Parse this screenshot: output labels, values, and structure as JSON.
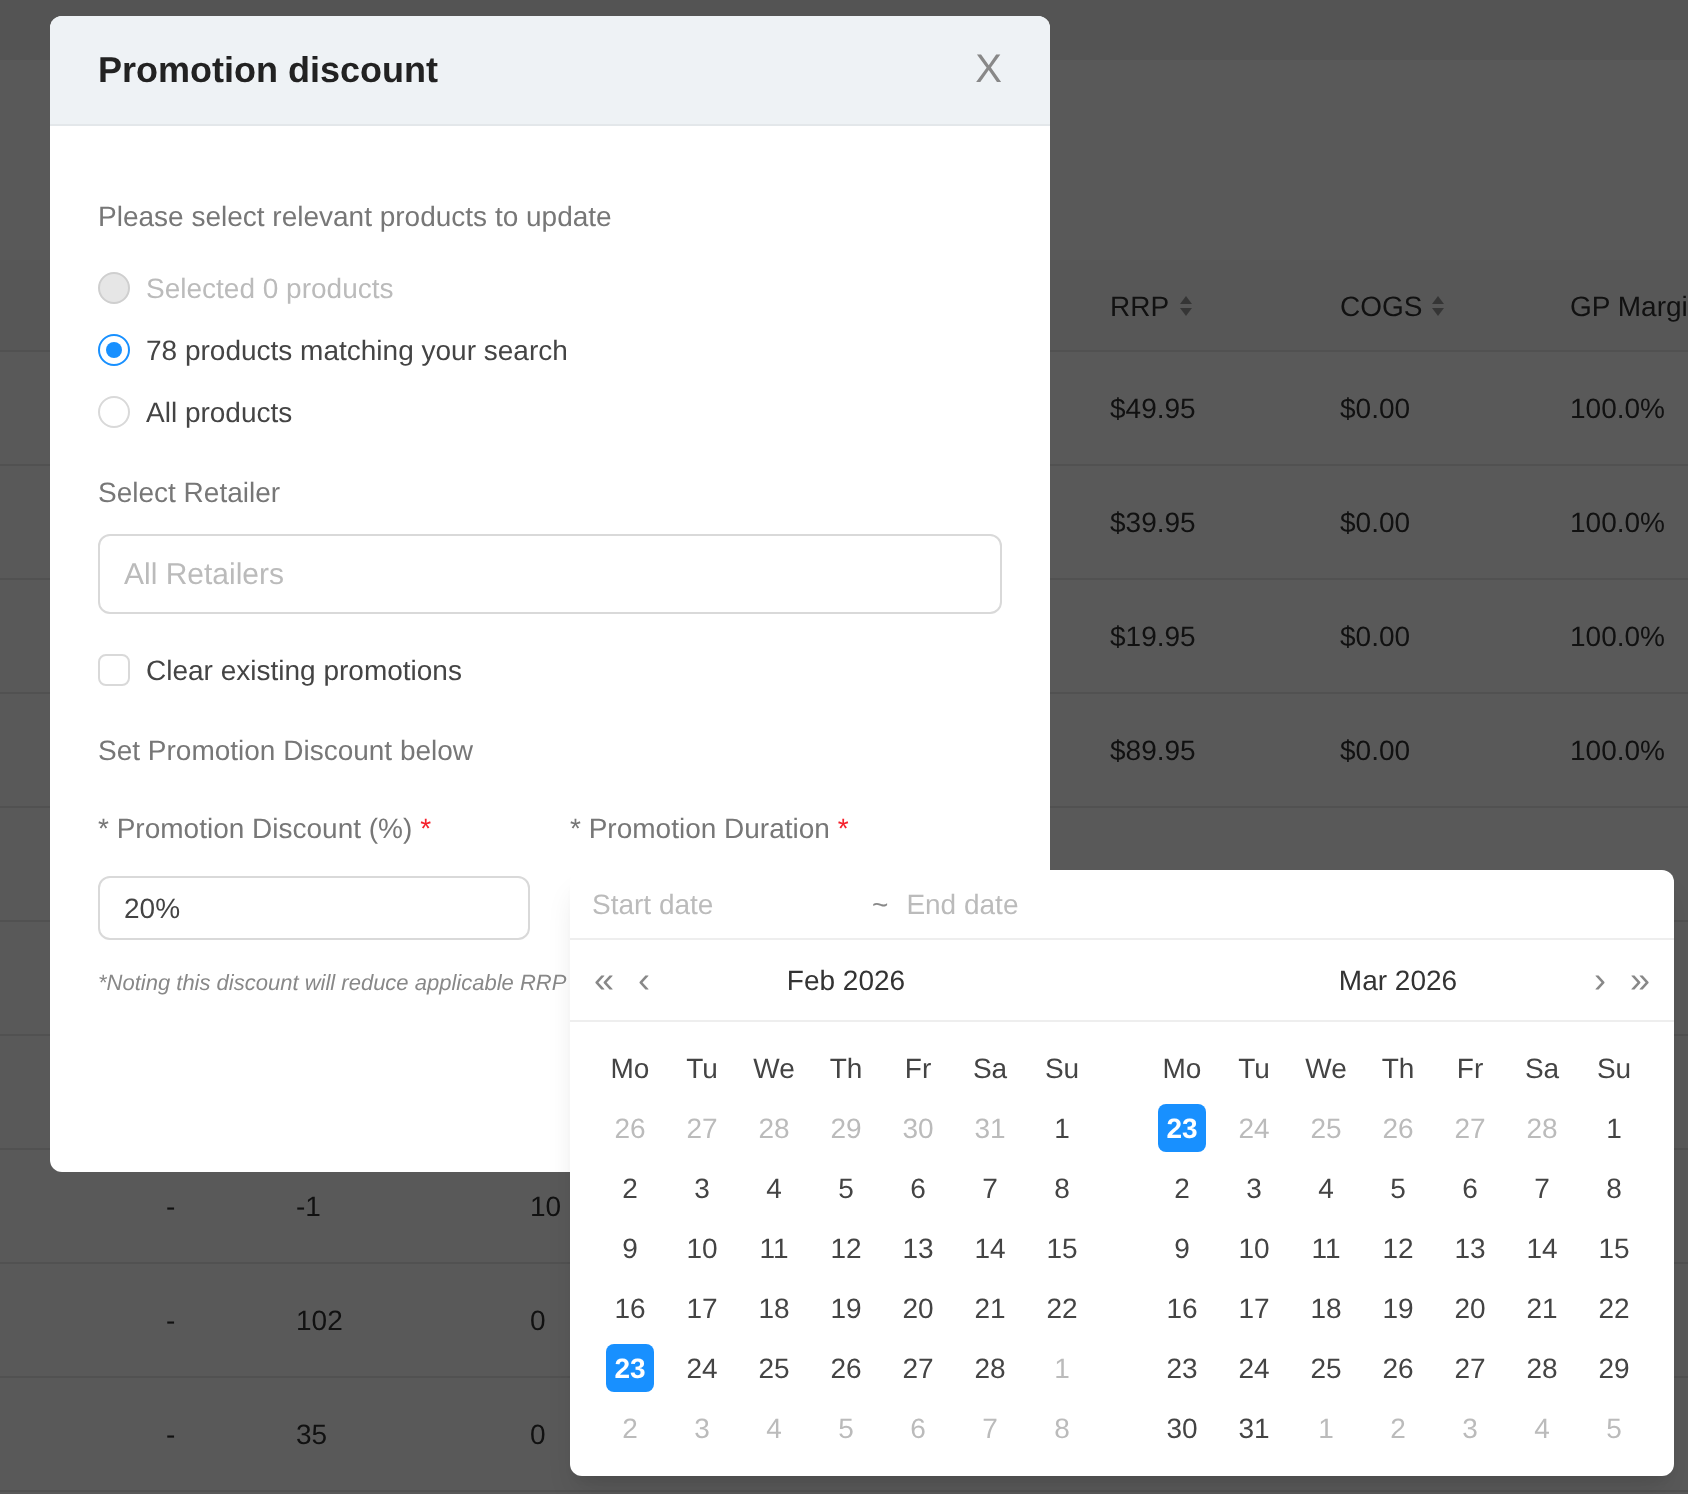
{
  "table": {
    "columns": [
      {
        "label": "RRP",
        "sortable": true
      },
      {
        "label": "COGS",
        "sortable": true
      },
      {
        "label": "GP Margi"
      }
    ],
    "upper_rows": [
      {
        "rrp": "$49.95",
        "cogs": "$0.00",
        "gp": "100.0%"
      },
      {
        "rrp": "$39.95",
        "cogs": "$0.00",
        "gp": "100.0%"
      },
      {
        "rrp": "$19.95",
        "cogs": "$0.00",
        "gp": "100.0%"
      },
      {
        "rrp": "$89.95",
        "cogs": "$0.00",
        "gp": "100.0%"
      }
    ],
    "lower_rows": [
      {
        "column_1": "-",
        "column_2": "-1",
        "column_3": "10"
      },
      {
        "column_1": "-",
        "column_2": "102",
        "column_3": "0"
      },
      {
        "column_1": "-",
        "column_2": "35",
        "column_3": "0"
      }
    ]
  },
  "dialog": {
    "title": "Promotion discount",
    "close": "X",
    "intro": "Please select relevant products to update",
    "scope_options": [
      {
        "label": "Selected 0 products",
        "selected": false,
        "disabled": true
      },
      {
        "label": "78 products matching your search",
        "selected": true,
        "disabled": false
      },
      {
        "label": "All products",
        "selected": false,
        "disabled": false
      }
    ],
    "retailer_label": "Select Retailer",
    "retailer": {
      "placeholder": "All Retailers"
    },
    "clear_promotions": {
      "label": "Clear existing promotions",
      "checked": false
    },
    "section_label": "Set Promotion Discount below",
    "discount_label": "* Promotion Discount (%)",
    "duration_label": "* Promotion Duration",
    "required_mark": "*",
    "discount": {
      "value": "20%"
    },
    "note": "*Noting this discount will reduce applicable RRP"
  },
  "date_picker": {
    "start": {
      "placeholder": "Start date"
    },
    "separator": "~",
    "end": {
      "placeholder": "End date"
    },
    "months": [
      {
        "title": "Feb 2026",
        "nav_left": [
          "«",
          "‹"
        ],
        "weekdays": [
          "Mo",
          "Tu",
          "We",
          "Th",
          "Fr",
          "Sa",
          "Su"
        ],
        "weeks": [
          [
            {
              "label": "26",
              "muted": true,
              "selected": false
            },
            {
              "label": "27",
              "muted": true,
              "selected": false
            },
            {
              "label": "28",
              "muted": true,
              "selected": false
            },
            {
              "label": "29",
              "muted": true,
              "selected": false
            },
            {
              "label": "30",
              "muted": true,
              "selected": false
            },
            {
              "label": "31",
              "muted": true,
              "selected": false
            },
            {
              "label": "1",
              "muted": false,
              "selected": false
            }
          ],
          [
            {
              "label": "2",
              "muted": false,
              "selected": false
            },
            {
              "label": "3",
              "muted": false,
              "selected": false
            },
            {
              "label": "4",
              "muted": false,
              "selected": false
            },
            {
              "label": "5",
              "muted": false,
              "selected": false
            },
            {
              "label": "6",
              "muted": false,
              "selected": false
            },
            {
              "label": "7",
              "muted": false,
              "selected": false
            },
            {
              "label": "8",
              "muted": false,
              "selected": false
            }
          ],
          [
            {
              "label": "9",
              "muted": false,
              "selected": false
            },
            {
              "label": "10",
              "muted": false,
              "selected": false
            },
            {
              "label": "11",
              "muted": false,
              "selected": false
            },
            {
              "label": "12",
              "muted": false,
              "selected": false
            },
            {
              "label": "13",
              "muted": false,
              "selected": false
            },
            {
              "label": "14",
              "muted": false,
              "selected": false
            },
            {
              "label": "15",
              "muted": false,
              "selected": false
            }
          ],
          [
            {
              "label": "16",
              "muted": false,
              "selected": false
            },
            {
              "label": "17",
              "muted": false,
              "selected": false
            },
            {
              "label": "18",
              "muted": false,
              "selected": false
            },
            {
              "label": "19",
              "muted": false,
              "selected": false
            },
            {
              "label": "20",
              "muted": false,
              "selected": false
            },
            {
              "label": "21",
              "muted": false,
              "selected": false
            },
            {
              "label": "22",
              "muted": false,
              "selected": false
            }
          ],
          [
            {
              "label": "23",
              "muted": false,
              "selected": true
            },
            {
              "label": "24",
              "muted": false,
              "selected": false
            },
            {
              "label": "25",
              "muted": false,
              "selected": false
            },
            {
              "label": "26",
              "muted": false,
              "selected": false
            },
            {
              "label": "27",
              "muted": false,
              "selected": false
            },
            {
              "label": "28",
              "muted": false,
              "selected": false
            },
            {
              "label": "1",
              "muted": true,
              "selected": false
            }
          ],
          [
            {
              "label": "2",
              "muted": true,
              "selected": false
            },
            {
              "label": "3",
              "muted": true,
              "selected": false
            },
            {
              "label": "4",
              "muted": true,
              "selected": false
            },
            {
              "label": "5",
              "muted": true,
              "selected": false
            },
            {
              "label": "6",
              "muted": true,
              "selected": false
            },
            {
              "label": "7",
              "muted": true,
              "selected": false
            },
            {
              "label": "8",
              "muted": true,
              "selected": false
            }
          ]
        ]
      },
      {
        "title": "Mar 2026",
        "nav_right": [
          "›",
          "»"
        ],
        "weekdays": [
          "Mo",
          "Tu",
          "We",
          "Th",
          "Fr",
          "Sa",
          "Su"
        ],
        "weeks": [
          [
            {
              "label": "23",
              "muted": false,
              "selected": true
            },
            {
              "label": "24",
              "muted": true,
              "selected": false
            },
            {
              "label": "25",
              "muted": true,
              "selected": false
            },
            {
              "label": "26",
              "muted": true,
              "selected": false
            },
            {
              "label": "27",
              "muted": true,
              "selected": false
            },
            {
              "label": "28",
              "muted": true,
              "selected": false
            },
            {
              "label": "1",
              "muted": false,
              "selected": false
            }
          ],
          [
            {
              "label": "2",
              "muted": false,
              "selected": false
            },
            {
              "label": "3",
              "muted": false,
              "selected": false
            },
            {
              "label": "4",
              "muted": false,
              "selected": false
            },
            {
              "label": "5",
              "muted": false,
              "selected": false
            },
            {
              "label": "6",
              "muted": false,
              "selected": false
            },
            {
              "label": "7",
              "muted": false,
              "selected": false
            },
            {
              "label": "8",
              "muted": false,
              "selected": false
            }
          ],
          [
            {
              "label": "9",
              "muted": false,
              "selected": false
            },
            {
              "label": "10",
              "muted": false,
              "selected": false
            },
            {
              "label": "11",
              "muted": false,
              "selected": false
            },
            {
              "label": "12",
              "muted": false,
              "selected": false
            },
            {
              "label": "13",
              "muted": false,
              "selected": false
            },
            {
              "label": "14",
              "muted": false,
              "selected": false
            },
            {
              "label": "15",
              "muted": false,
              "selected": false
            }
          ],
          [
            {
              "label": "16",
              "muted": false,
              "selected": false
            },
            {
              "label": "17",
              "muted": false,
              "selected": false
            },
            {
              "label": "18",
              "muted": false,
              "selected": false
            },
            {
              "label": "19",
              "muted": false,
              "selected": false
            },
            {
              "label": "20",
              "muted": false,
              "selected": false
            },
            {
              "label": "21",
              "muted": false,
              "selected": false
            },
            {
              "label": "22",
              "muted": false,
              "selected": false
            }
          ],
          [
            {
              "label": "23",
              "muted": false,
              "selected": false
            },
            {
              "label": "24",
              "muted": false,
              "selected": false
            },
            {
              "label": "25",
              "muted": false,
              "selected": false
            },
            {
              "label": "26",
              "muted": false,
              "selected": false
            },
            {
              "label": "27",
              "muted": false,
              "selected": false
            },
            {
              "label": "28",
              "muted": false,
              "selected": false
            },
            {
              "label": "29",
              "muted": false,
              "selected": false
            }
          ],
          [
            {
              "label": "30",
              "muted": false,
              "selected": false
            },
            {
              "label": "31",
              "muted": false,
              "selected": false
            },
            {
              "label": "1",
              "muted": true,
              "selected": false
            },
            {
              "label": "2",
              "muted": true,
              "selected": false
            },
            {
              "label": "3",
              "muted": true,
              "selected": false
            },
            {
              "label": "4",
              "muted": true,
              "selected": false
            },
            {
              "label": "5",
              "muted": true,
              "selected": false
            }
          ]
        ]
      }
    ]
  }
}
